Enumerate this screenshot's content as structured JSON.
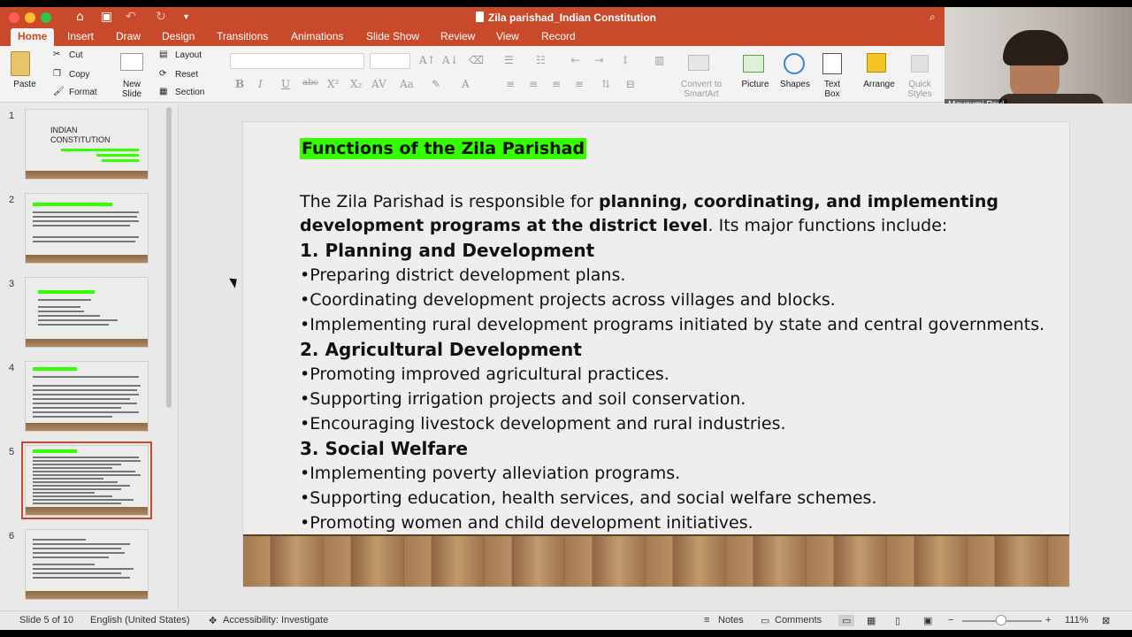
{
  "window": {
    "title": "Zila parishad_Indian Constitution"
  },
  "tabs": [
    "Home",
    "Insert",
    "Draw",
    "Design",
    "Transitions",
    "Animations",
    "Slide Show",
    "Review",
    "View",
    "Record"
  ],
  "ribbon": {
    "paste": "Paste",
    "cut": "Cut",
    "copy": "Copy",
    "format": "Format",
    "new_slide": "New\nSlide",
    "new_slide_l1": "New",
    "new_slide_l2": "Slide",
    "layout": "Layout",
    "reset": "Reset",
    "section": "Section",
    "convert_l1": "Convert to",
    "convert_l2": "SmartArt",
    "picture": "Picture",
    "shapes": "Shapes",
    "textbox_l1": "Text",
    "textbox_l2": "Box",
    "arrange": "Arrange",
    "quick_l1": "Quick",
    "quick_l2": "Styles"
  },
  "video": {
    "name": "Mousumi Paul"
  },
  "thumbnails": [
    "1",
    "2",
    "3",
    "4",
    "5",
    "6"
  ],
  "thumb1": {
    "title_l1": "INDIAN",
    "title_l2": "CONSTITUTION"
  },
  "slide": {
    "title": "Functions of the Zila Parishad",
    "intro_l1_a": "The Zila Parishad is responsible for ",
    "intro_l1_b": "planning, coordinating, and implementing",
    "intro_l2_a": "development programs at the district level",
    "intro_l2_b": ". Its major functions include:",
    "h1": "1. Planning and Development",
    "b1": "•Preparing district development plans.",
    "b2": "•Coordinating development projects across villages and blocks.",
    "b3": "•Implementing rural development programs initiated by state and central governments.",
    "h2": "2. Agricultural Development",
    "b4": "•Promoting improved agricultural practices.",
    "b5": "•Supporting irrigation projects and soil conservation.",
    "b6": "•Encouraging livestock development and rural industries.",
    "h3": "3. Social Welfare",
    "b7": "•Implementing poverty alleviation programs.",
    "b8": "•Supporting education, health services, and social welfare schemes.",
    "b9": "•Promoting women and child development initiatives."
  },
  "status": {
    "slide_count": "Slide 5 of 10",
    "language": "English (United States)",
    "accessibility": "Accessibility: Investigate",
    "notes": "Notes",
    "comments": "Comments",
    "zoom": "111%"
  },
  "colors": {
    "accent": "#c94a2b",
    "highlight": "#33ff00"
  }
}
